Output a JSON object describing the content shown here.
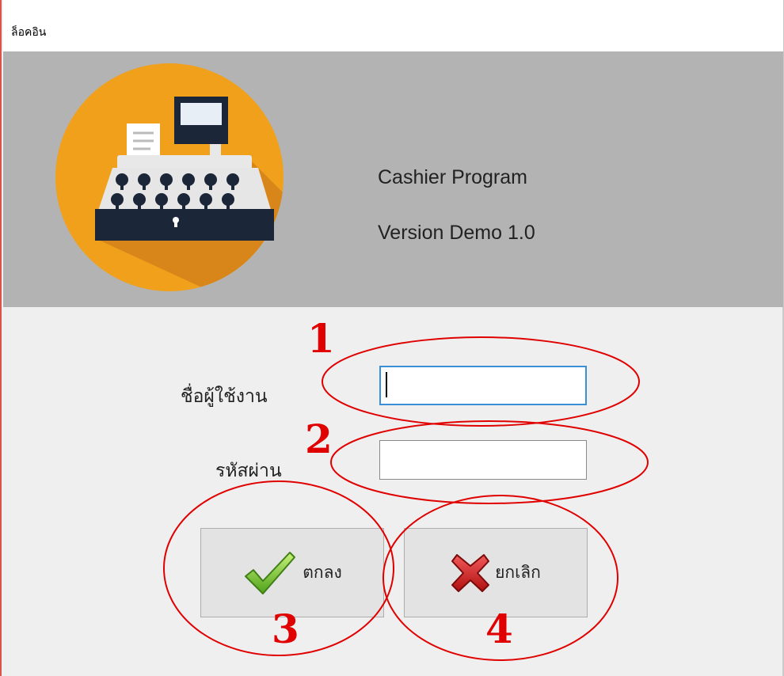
{
  "window": {
    "title": "ล็อคอิน"
  },
  "header": {
    "app_name": "Cashier Program",
    "app_version": "Version Demo 1.0",
    "logo_icon": "cash-register-icon",
    "logo_color": "#f0a01a"
  },
  "form": {
    "username_label": "ชื่อผู้ใช้งาน",
    "username_value": "",
    "password_label": "รหัสผ่าน",
    "password_value": "",
    "ok_button": {
      "label": "ตกลง",
      "icon": "checkmark-icon"
    },
    "cancel_button": {
      "label": "ยกเลิก",
      "icon": "red-x-icon"
    }
  },
  "annotations": {
    "marker_1": "1",
    "marker_2": "2",
    "marker_3": "3",
    "marker_4": "4",
    "color": "#e00000"
  }
}
